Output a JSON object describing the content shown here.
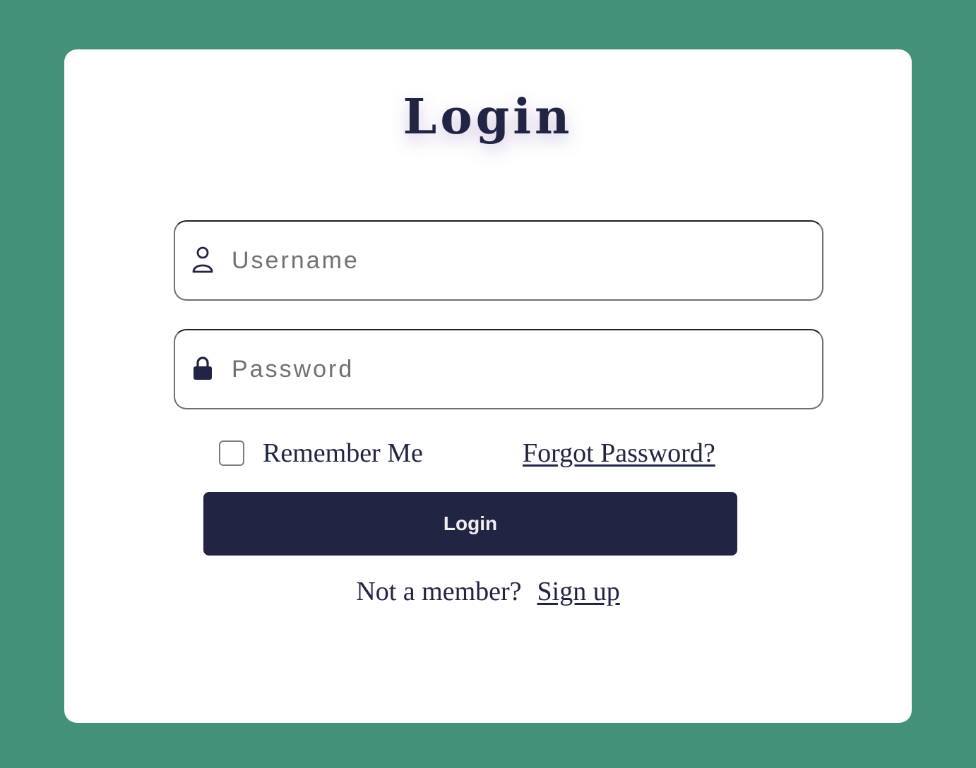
{
  "page": {
    "background_color": "#44917a",
    "card_color": "#ffffff",
    "accent_color": "#212443"
  },
  "login_form": {
    "title": "Login",
    "username": {
      "icon": "user-icon",
      "placeholder": "Username",
      "value": ""
    },
    "password": {
      "icon": "lock-icon",
      "placeholder": "Password",
      "value": ""
    },
    "remember_me": {
      "label": "Remember Me",
      "checked": false
    },
    "forgot_password_label": "Forgot Password?",
    "submit_label": "Login",
    "signup_prompt": "Not a member?",
    "signup_link_label": "Sign up"
  }
}
